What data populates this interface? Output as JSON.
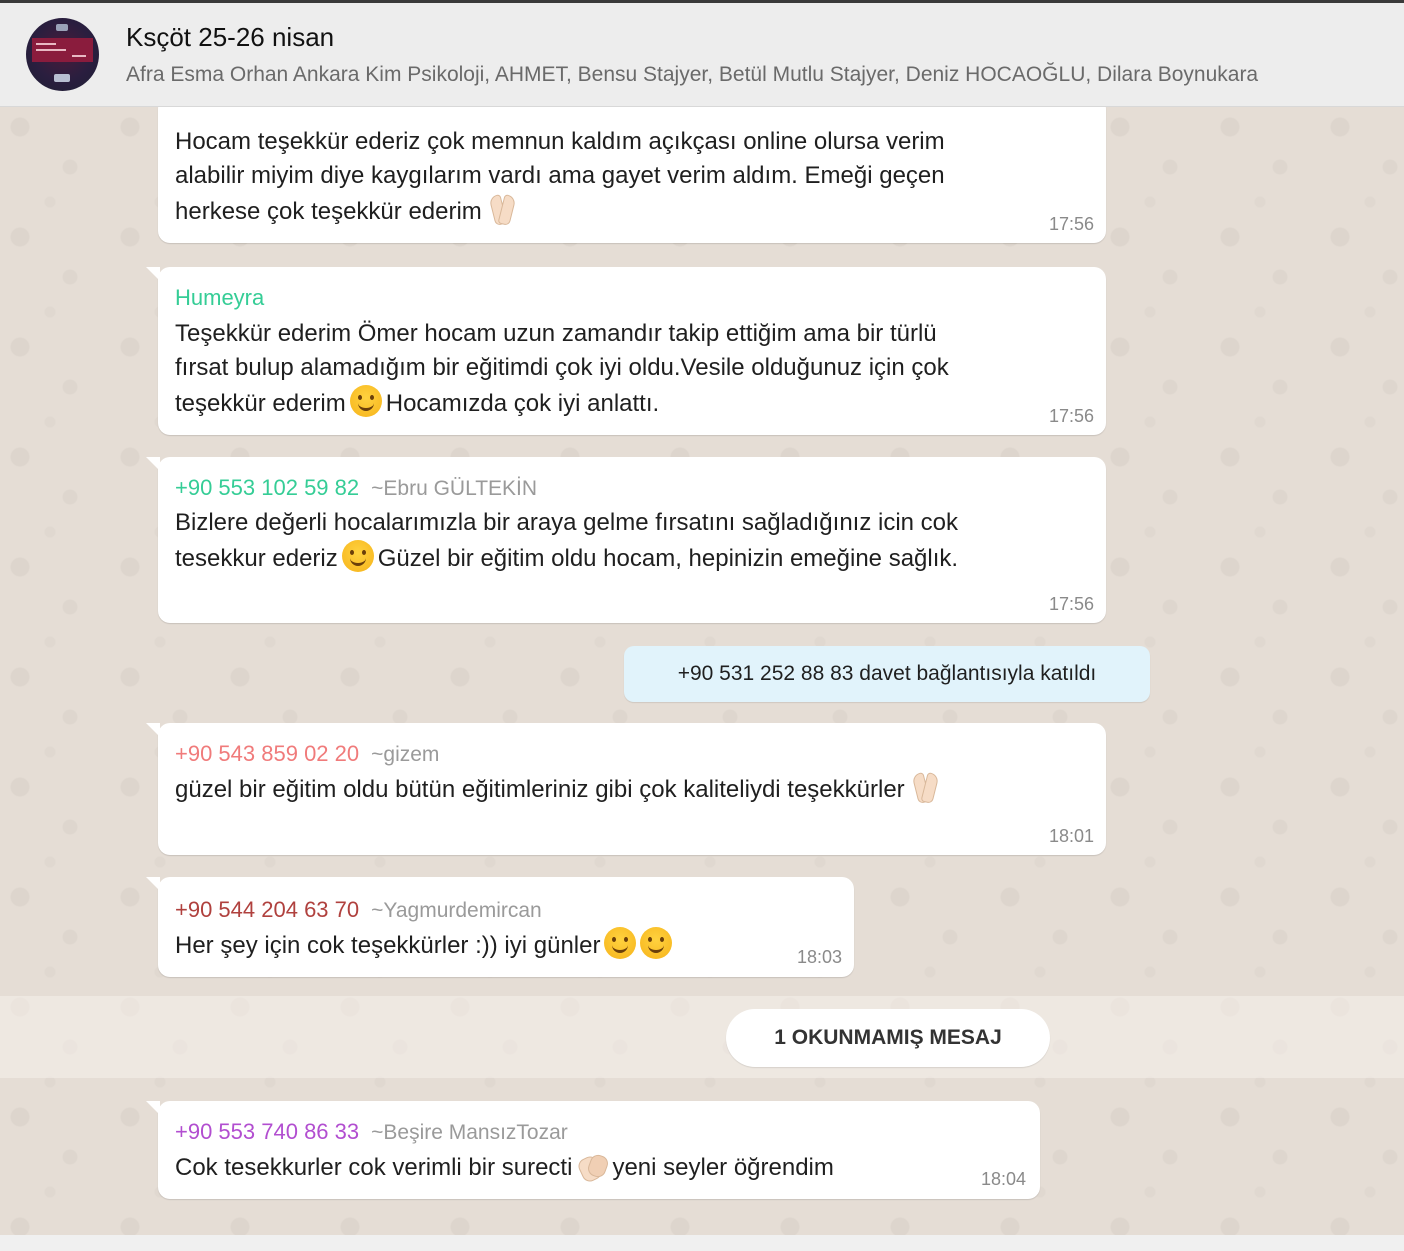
{
  "header": {
    "title": "Ksçöt 25-26 nisan",
    "participants": "Afra Esma Orhan Ankara Kim Psikoloji, AHMET, Bensu Stajyer, Betül Mutlu Stajyer, Deniz HOCAOĞLU, Dilara Boynukara"
  },
  "colors": {
    "chat_background": "#e5ddd5",
    "bubble_incoming": "#ffffff",
    "system_bubble": "#e1f3fb",
    "header_background": "#ededed"
  },
  "messages": [
    {
      "sender": "",
      "push_name": "",
      "lines": [
        "Hocam teşekkür ederiz çok memnun kaldım açıkçası online olursa verim",
        "alabilir miyim diye kaygılarım vardı ama gayet verim aldım. Emeği geçen",
        "herkese çok teşekkür ederim"
      ],
      "emoji": "folded-hands-icon",
      "time": "17:56"
    },
    {
      "sender": "Humeyra",
      "sender_color": "#35cd96",
      "lines": [
        "Teşekkür ederim Ömer hocam uzun zamandır takip ettiğim ama bir türlü",
        "fırsat bulup alamadığım bir eğitimdi çok iyi oldu.Vesile olduğunuz için çok",
        "teşekkür ederim",
        "Hocamızda çok iyi anlattı."
      ],
      "emoji": "smiling-face-icon",
      "time": "17:56"
    },
    {
      "sender": "+90 553 102 59 82",
      "sender_color": "#35cd96",
      "push_name": "~Ebru GÜLTEKİN",
      "lines": [
        "Bizlere değerli hocalarımızla bir araya gelme fırsatını sağladığınız icin cok",
        "tesekkur ederiz",
        "Güzel bir eğitim oldu hocam, hepinizin emeğine sağlık."
      ],
      "emoji": "relaxed-face-icon",
      "time": "17:56"
    },
    {
      "system": "+90 531 252 88 83 davet bağlantısıyla katıldı"
    },
    {
      "sender": "+90 543 859 02 20",
      "sender_color": "#f07b7b",
      "push_name": "~gizem",
      "lines": [
        "güzel bir eğitim oldu bütün eğitimleriniz gibi çok kaliteliydi teşekkürler"
      ],
      "emoji": "folded-hands-icon",
      "time": "18:01"
    },
    {
      "sender": "+90 544 204 63 70",
      "sender_color": "#b0413e",
      "push_name": "~Yagmurdemircan",
      "lines": [
        "Her şey için cok teşekkürler :)) iyi günler"
      ],
      "emoji": "smiling-face-icon",
      "time": "18:03"
    },
    {
      "unread_divider": "1 OKUNMAMIŞ MESAJ"
    },
    {
      "sender": "+90 553 740 86 33",
      "sender_color": "#b24ed0",
      "push_name": "~Beşire MansızTozar",
      "lines": [
        "Cok tesekkurler cok verimli bir surecti",
        "yeni seyler öğrendim"
      ],
      "emoji": "clapping-hands-icon",
      "time": "18:04"
    }
  ]
}
